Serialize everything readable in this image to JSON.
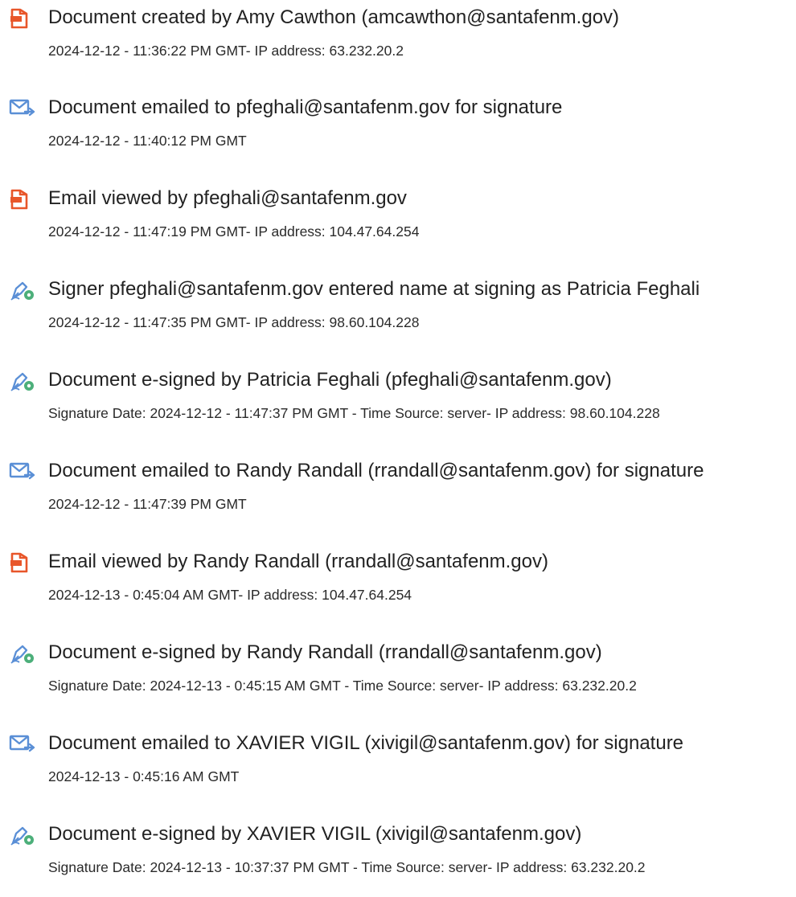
{
  "icons": {
    "document": "document-icon",
    "email": "email-send-icon",
    "esign": "esign-pen-icon"
  },
  "colors": {
    "document_icon": "#e8562a",
    "email_icon": "#5a8fd6",
    "esign_icon": "#4caf7a"
  },
  "entries": [
    {
      "icon": "document-icon",
      "title": "Document created by Amy Cawthon (amcawthon@santafenm.gov)",
      "detail": "2024-12-12 - 11:36:22 PM GMT- IP address: 63.232.20.2"
    },
    {
      "icon": "email-send-icon",
      "title": "Document emailed to pfeghali@santafenm.gov for signature",
      "detail": "2024-12-12 - 11:40:12 PM GMT"
    },
    {
      "icon": "document-icon",
      "title": "Email viewed by pfeghali@santafenm.gov",
      "detail": "2024-12-12 - 11:47:19 PM GMT- IP address: 104.47.64.254"
    },
    {
      "icon": "esign-pen-icon",
      "title": "Signer pfeghali@santafenm.gov entered name at signing as Patricia Feghali",
      "detail": "2024-12-12 - 11:47:35 PM GMT- IP address: 98.60.104.228"
    },
    {
      "icon": "esign-pen-icon",
      "title": "Document e-signed by Patricia Feghali (pfeghali@santafenm.gov)",
      "detail": "Signature Date: 2024-12-12 - 11:47:37 PM GMT - Time Source: server- IP address: 98.60.104.228"
    },
    {
      "icon": "email-send-icon",
      "title": "Document emailed to Randy Randall (rrandall@santafenm.gov) for signature",
      "detail": "2024-12-12 - 11:47:39 PM GMT"
    },
    {
      "icon": "document-icon",
      "title": "Email viewed by Randy Randall (rrandall@santafenm.gov)",
      "detail": "2024-12-13 - 0:45:04 AM GMT- IP address: 104.47.64.254"
    },
    {
      "icon": "esign-pen-icon",
      "title": "Document e-signed by Randy Randall (rrandall@santafenm.gov)",
      "detail": "Signature Date: 2024-12-13 - 0:45:15 AM GMT - Time Source: server- IP address: 63.232.20.2"
    },
    {
      "icon": "email-send-icon",
      "title": "Document emailed to XAVIER VIGIL (xivigil@santafenm.gov) for signature",
      "detail": "2024-12-13 - 0:45:16 AM GMT"
    },
    {
      "icon": "esign-pen-icon",
      "title": "Document e-signed by XAVIER VIGIL (xivigil@santafenm.gov)",
      "detail": "Signature Date: 2024-12-13 - 10:37:37 PM GMT - Time Source: server- IP address: 63.232.20.2"
    }
  ]
}
